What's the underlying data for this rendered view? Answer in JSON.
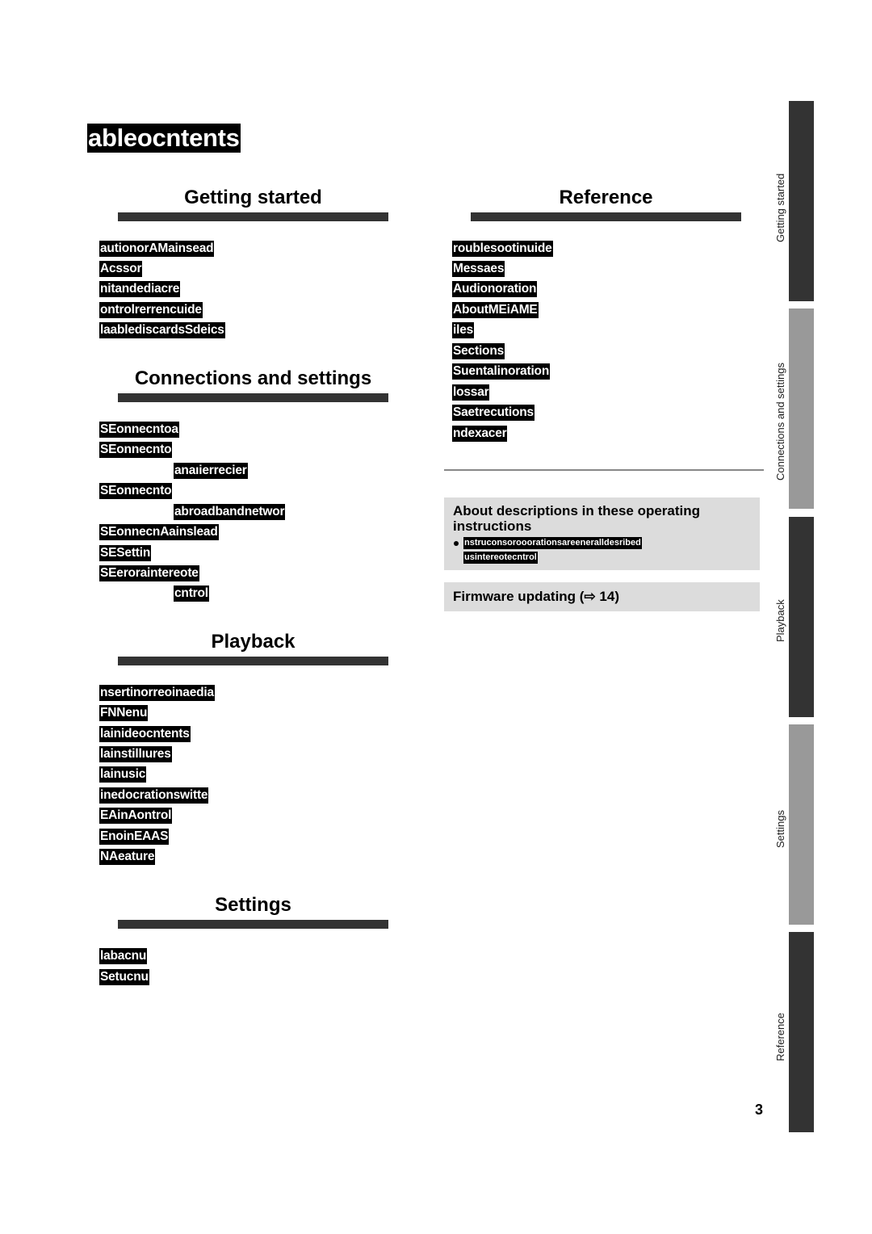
{
  "page": {
    "title": "ableocntents",
    "page_number": "3"
  },
  "sections": {
    "getting_started": {
      "heading": "Getting started",
      "items": [
        "autionorAMainsead",
        "Acssor",
        "nitandediacre",
        "ontrolrerrencuide",
        "laablediscardsSdeics"
      ]
    },
    "connections": {
      "heading": "Connections and settings",
      "items": [
        "SEonnecntoa",
        "SEonnecnto",
        "anaıierrecier",
        "SEonnecnto",
        "abroadbandnetwor",
        "SEonnecnAainslead",
        "SESettin",
        "SEeroraintereote",
        "cntrol"
      ]
    },
    "playback": {
      "heading": "Playback",
      "items": [
        "nsertinorreoinaedia",
        "FNNenu",
        "lainideocntents",
        "lainstillıures",
        "lainusic",
        "inedocrationswitte",
        "EAinAontrol",
        "EnoinEAAS",
        "NAeature"
      ]
    },
    "settings": {
      "heading": "Settings",
      "items": [
        "labacnu",
        "Setucnu"
      ]
    },
    "reference": {
      "heading": "Reference",
      "items": [
        "roublesootinuide",
        "Messaes",
        "Audionoration",
        "AboutMEiAME",
        "iles",
        "Sections",
        "Suentalinoration",
        "lossar",
        "Saetrecutions",
        "ndexacer"
      ]
    }
  },
  "notes": {
    "about": {
      "title": "About descriptions in these operating instructions",
      "bullet_lines": [
        "nstruconsorooorationsareeneralldesribed",
        "usintereotecntrol"
      ]
    },
    "firmware": {
      "title": "Firmware updating (⇨ 14)"
    }
  },
  "side_tabs": [
    {
      "label": "Getting started",
      "color": "#333333"
    },
    {
      "label": "Connections and settings",
      "color": "#999999"
    },
    {
      "label": "Playback",
      "color": "#333333"
    },
    {
      "label": "Settings",
      "color": "#999999"
    },
    {
      "label": "Reference",
      "color": "#333333"
    }
  ]
}
